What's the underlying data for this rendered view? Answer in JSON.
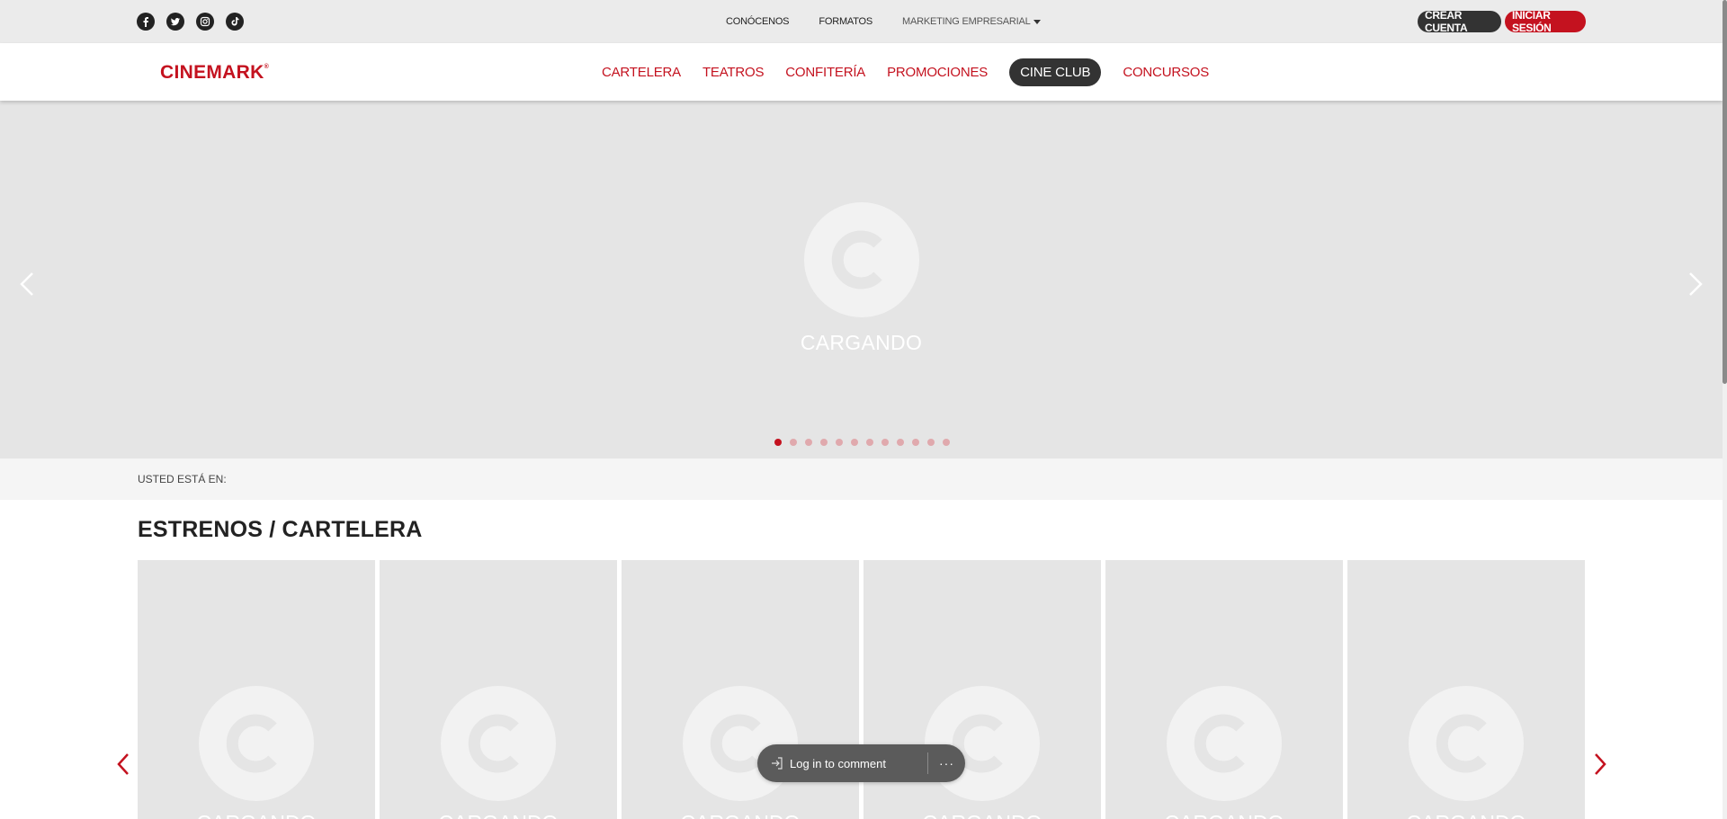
{
  "topbar": {
    "social": [
      {
        "name": "facebook-icon"
      },
      {
        "name": "twitter-icon"
      },
      {
        "name": "instagram-icon"
      },
      {
        "name": "tiktok-icon"
      }
    ],
    "links": {
      "conocenos": "CONÓCENOS",
      "formatos": "FORMATOS",
      "marketing": "MARKETING EMPRESARIAL"
    },
    "crear_cuenta": "CREAR CUENTA",
    "iniciar_sesion": "INICIAR SESIÓN"
  },
  "header": {
    "logo": "CINEMARK",
    "logo_mark": "®",
    "nav": {
      "cartelera": "CARTELERA",
      "teatros": "TEATROS",
      "confiteria": "CONFITERÍA",
      "promociones": "PROMOCIONES",
      "cine_club": "CINE CLUB",
      "concursos": "CONCURSOS"
    }
  },
  "hero": {
    "loading_text": "CARGANDO",
    "dots_total": 12,
    "active_dot": 1
  },
  "breadcrumb": {
    "label": "USTED ESTÁ EN:"
  },
  "section": {
    "title": "ESTRENOS / CARTELERA",
    "cards": [
      {
        "loading": "CARGANDO"
      },
      {
        "loading": "CARGANDO"
      },
      {
        "loading": "CARGANDO"
      },
      {
        "loading": "CARGANDO"
      },
      {
        "loading": "CARGANDO"
      },
      {
        "loading": "CARGANDO"
      }
    ]
  },
  "comment_widget": {
    "login_label": "Log in to comment",
    "more_label": "···"
  },
  "colors": {
    "brand_red": "#c4121f",
    "dark": "#333333",
    "placeholder_gray": "#e5e5e5"
  }
}
